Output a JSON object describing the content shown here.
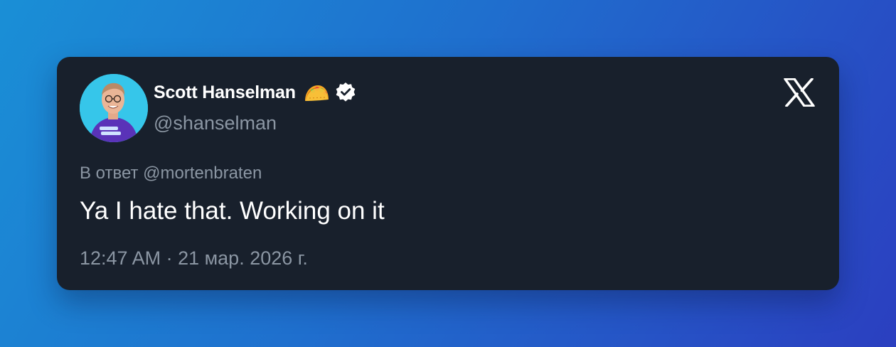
{
  "author": {
    "display_name": "Scott Hanselman",
    "name_emoji": "taco-icon",
    "verified_badge": "verified-badge-icon",
    "handle": "@shanselman"
  },
  "tweet": {
    "reply_line": "В ответ @mortenbraten",
    "text": "Ya I hate that. Working on it",
    "timestamp": "12:47 AM · 21 мар. 2026 г."
  },
  "icons": {
    "brand": "x-logo-icon"
  },
  "colors": {
    "card_background": "#18202c",
    "primary_text": "#ffffff",
    "secondary_text": "#8b96a3",
    "avatar_background": "#36c6ea",
    "gradient_start": "#1a8fd6",
    "gradient_end": "#2b3fc0"
  }
}
